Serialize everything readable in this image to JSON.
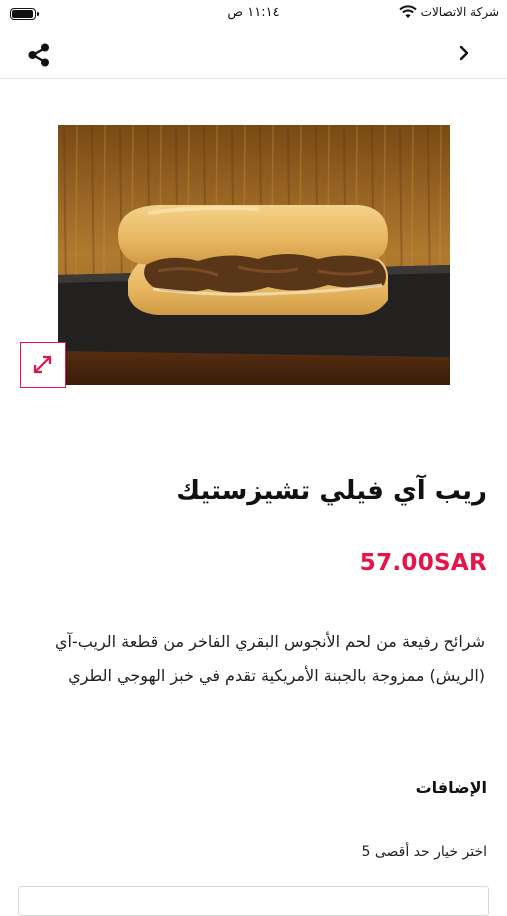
{
  "status_bar": {
    "time": "١١:١٤ ص",
    "carrier": "شركة الاتصالات",
    "battery_icon": "battery-icon",
    "wifi_icon": "wifi-icon"
  },
  "nav": {
    "share_icon": "share-icon",
    "back_icon": "chevron-icon"
  },
  "product": {
    "image_alt": "ريب آي فيلي تشيزستيك",
    "expand_icon": "expand-icon",
    "title": "ريب آي فيلي تشيزستيك",
    "price": "57.00SAR",
    "description": "شرائح رفيعة من لحم الأنجوس البقري الفاخر من قطعة الريب-آي (الريش) ممزوجة بالجبنة الأمريكية تقدم في خبز الهوجي الطري"
  },
  "addons": {
    "title": "الإضافات",
    "hint": "اختر خيار حد أقصى 5"
  },
  "colors": {
    "accent": "#e5154a"
  }
}
